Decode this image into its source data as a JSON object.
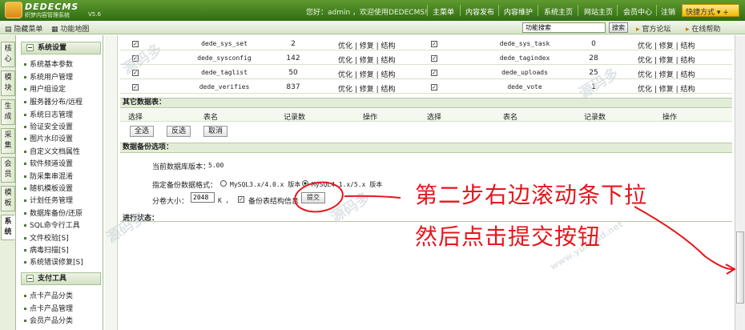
{
  "header": {
    "brand": "DEDECMS",
    "brand_sub": "织梦内容管理系统",
    "version": "V5.6",
    "welcome": "您好：admin ，欢迎使用DEDECMS!",
    "nav": [
      "主菜单",
      "内容发布",
      "内容维护",
      "系统主页",
      "网站主页",
      "会员中心",
      "注销"
    ],
    "quick_label": "快捷方式"
  },
  "subbar": {
    "hide_menu": "隐藏菜单",
    "func_map": "功能地图",
    "search_value": "功能搜索",
    "search_btn": "搜索",
    "forum": "官方论坛",
    "help": "在线帮助"
  },
  "left_tabs": [
    "核心",
    "模块",
    "生成",
    "采集",
    "会员",
    "模板",
    "系统"
  ],
  "menu": {
    "sys_title": "系统设置",
    "sys_items": [
      "系统基本参数",
      "系统用户管理",
      "用户组设定",
      "服务器分布/远程",
      "系统日志管理",
      "验证安全设置",
      "图片水印设置",
      "自定义文档属性",
      "软件频道设置",
      "防采集串混淆",
      "随机模板设置",
      "计划任务管理",
      "数据库备份/还原",
      "SQL命令行工具",
      "文件校验[S]",
      "病毒扫描[S]",
      "系统错误修复[S]"
    ],
    "pay_title": "支付工具",
    "pay_items": [
      "点卡产品分类",
      "点卡产品管理",
      "会员产品分类"
    ]
  },
  "tables": {
    "rows": [
      {
        "left": {
          "name": "dede_sys_set",
          "count": "2"
        },
        "right": {
          "name": "dede_sys_task",
          "count": "0"
        }
      },
      {
        "left": {
          "name": "dede_sysconfig",
          "count": "142"
        },
        "right": {
          "name": "dede_tagindex",
          "count": "28"
        }
      },
      {
        "left": {
          "name": "dede_taglist",
          "count": "50"
        },
        "right": {
          "name": "dede_uploads",
          "count": "25"
        }
      },
      {
        "left": {
          "name": "dede_verifies",
          "count": "837"
        },
        "right": {
          "name": "dede_vote",
          "count": "1"
        }
      }
    ],
    "ops": "优化 | 修复 | 结构"
  },
  "other_tables": {
    "title": "其它数据表：",
    "headers": [
      "选择",
      "表名",
      "记录数",
      "操作",
      "选择",
      "表名",
      "记录数",
      "操作"
    ],
    "select_all": "全选",
    "invert": "反选",
    "cancel": "取消"
  },
  "backup": {
    "title": "数据备份选项：",
    "db_version_label": "当前数据库版本：",
    "db_version": "5.00",
    "format_label": "指定备份数据格式：",
    "format_opt1": "MySQL3.x/4.0.x 版本",
    "format_opt2": "MySQL4.1.x/5.x 版本",
    "format_selected": "MySQL4.1.x/5.x 版本",
    "volume_label": "分卷大小：",
    "volume_value": "2048",
    "volume_unit": "K ，",
    "struct_label": "备份表结构信息",
    "submit": "提交"
  },
  "progress": {
    "title": "进行状态："
  },
  "annotation": {
    "line1": "第二步右边滚动条下拉",
    "line2": "然后点击提交按钮"
  },
  "watermark": "源码多",
  "watermark_url": "www.yuandd.net",
  "colors": {
    "header": "#3f7d1f",
    "annotation": "#e8141c",
    "quick": "#f1b800"
  }
}
